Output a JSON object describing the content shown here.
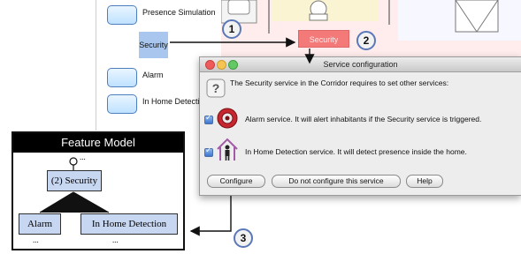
{
  "services": {
    "items": [
      {
        "label": "Presence Simulation"
      },
      {
        "label": "Security"
      },
      {
        "label": "Alarm"
      },
      {
        "label": "In Home Detection"
      }
    ]
  },
  "floorplan": {
    "security_tag": "Security"
  },
  "dialog": {
    "title": "Service configuration",
    "message": "The Security service in the Corridor requires to set other services:",
    "options": [
      {
        "text": "Alarm service. It will alert inhabitants if the Security service is triggered."
      },
      {
        "text": "In Home Detection service. It will detect presence inside the home."
      }
    ],
    "buttons": {
      "configure": "Configure",
      "do_not_configure": "Do not configure this service",
      "help": "Help"
    }
  },
  "feature_model": {
    "title": "Feature Model",
    "root": "(2) Security",
    "children": [
      "Alarm",
      "In Home Detection"
    ],
    "ellipsis": "..."
  },
  "callouts": [
    "1",
    "2",
    "3"
  ],
  "colors": {
    "selected_service": "#a9c7ee",
    "highlight_red": "#f47a7a",
    "feature_node": "#c8d7f1",
    "callout_border": "#5a78b8"
  }
}
